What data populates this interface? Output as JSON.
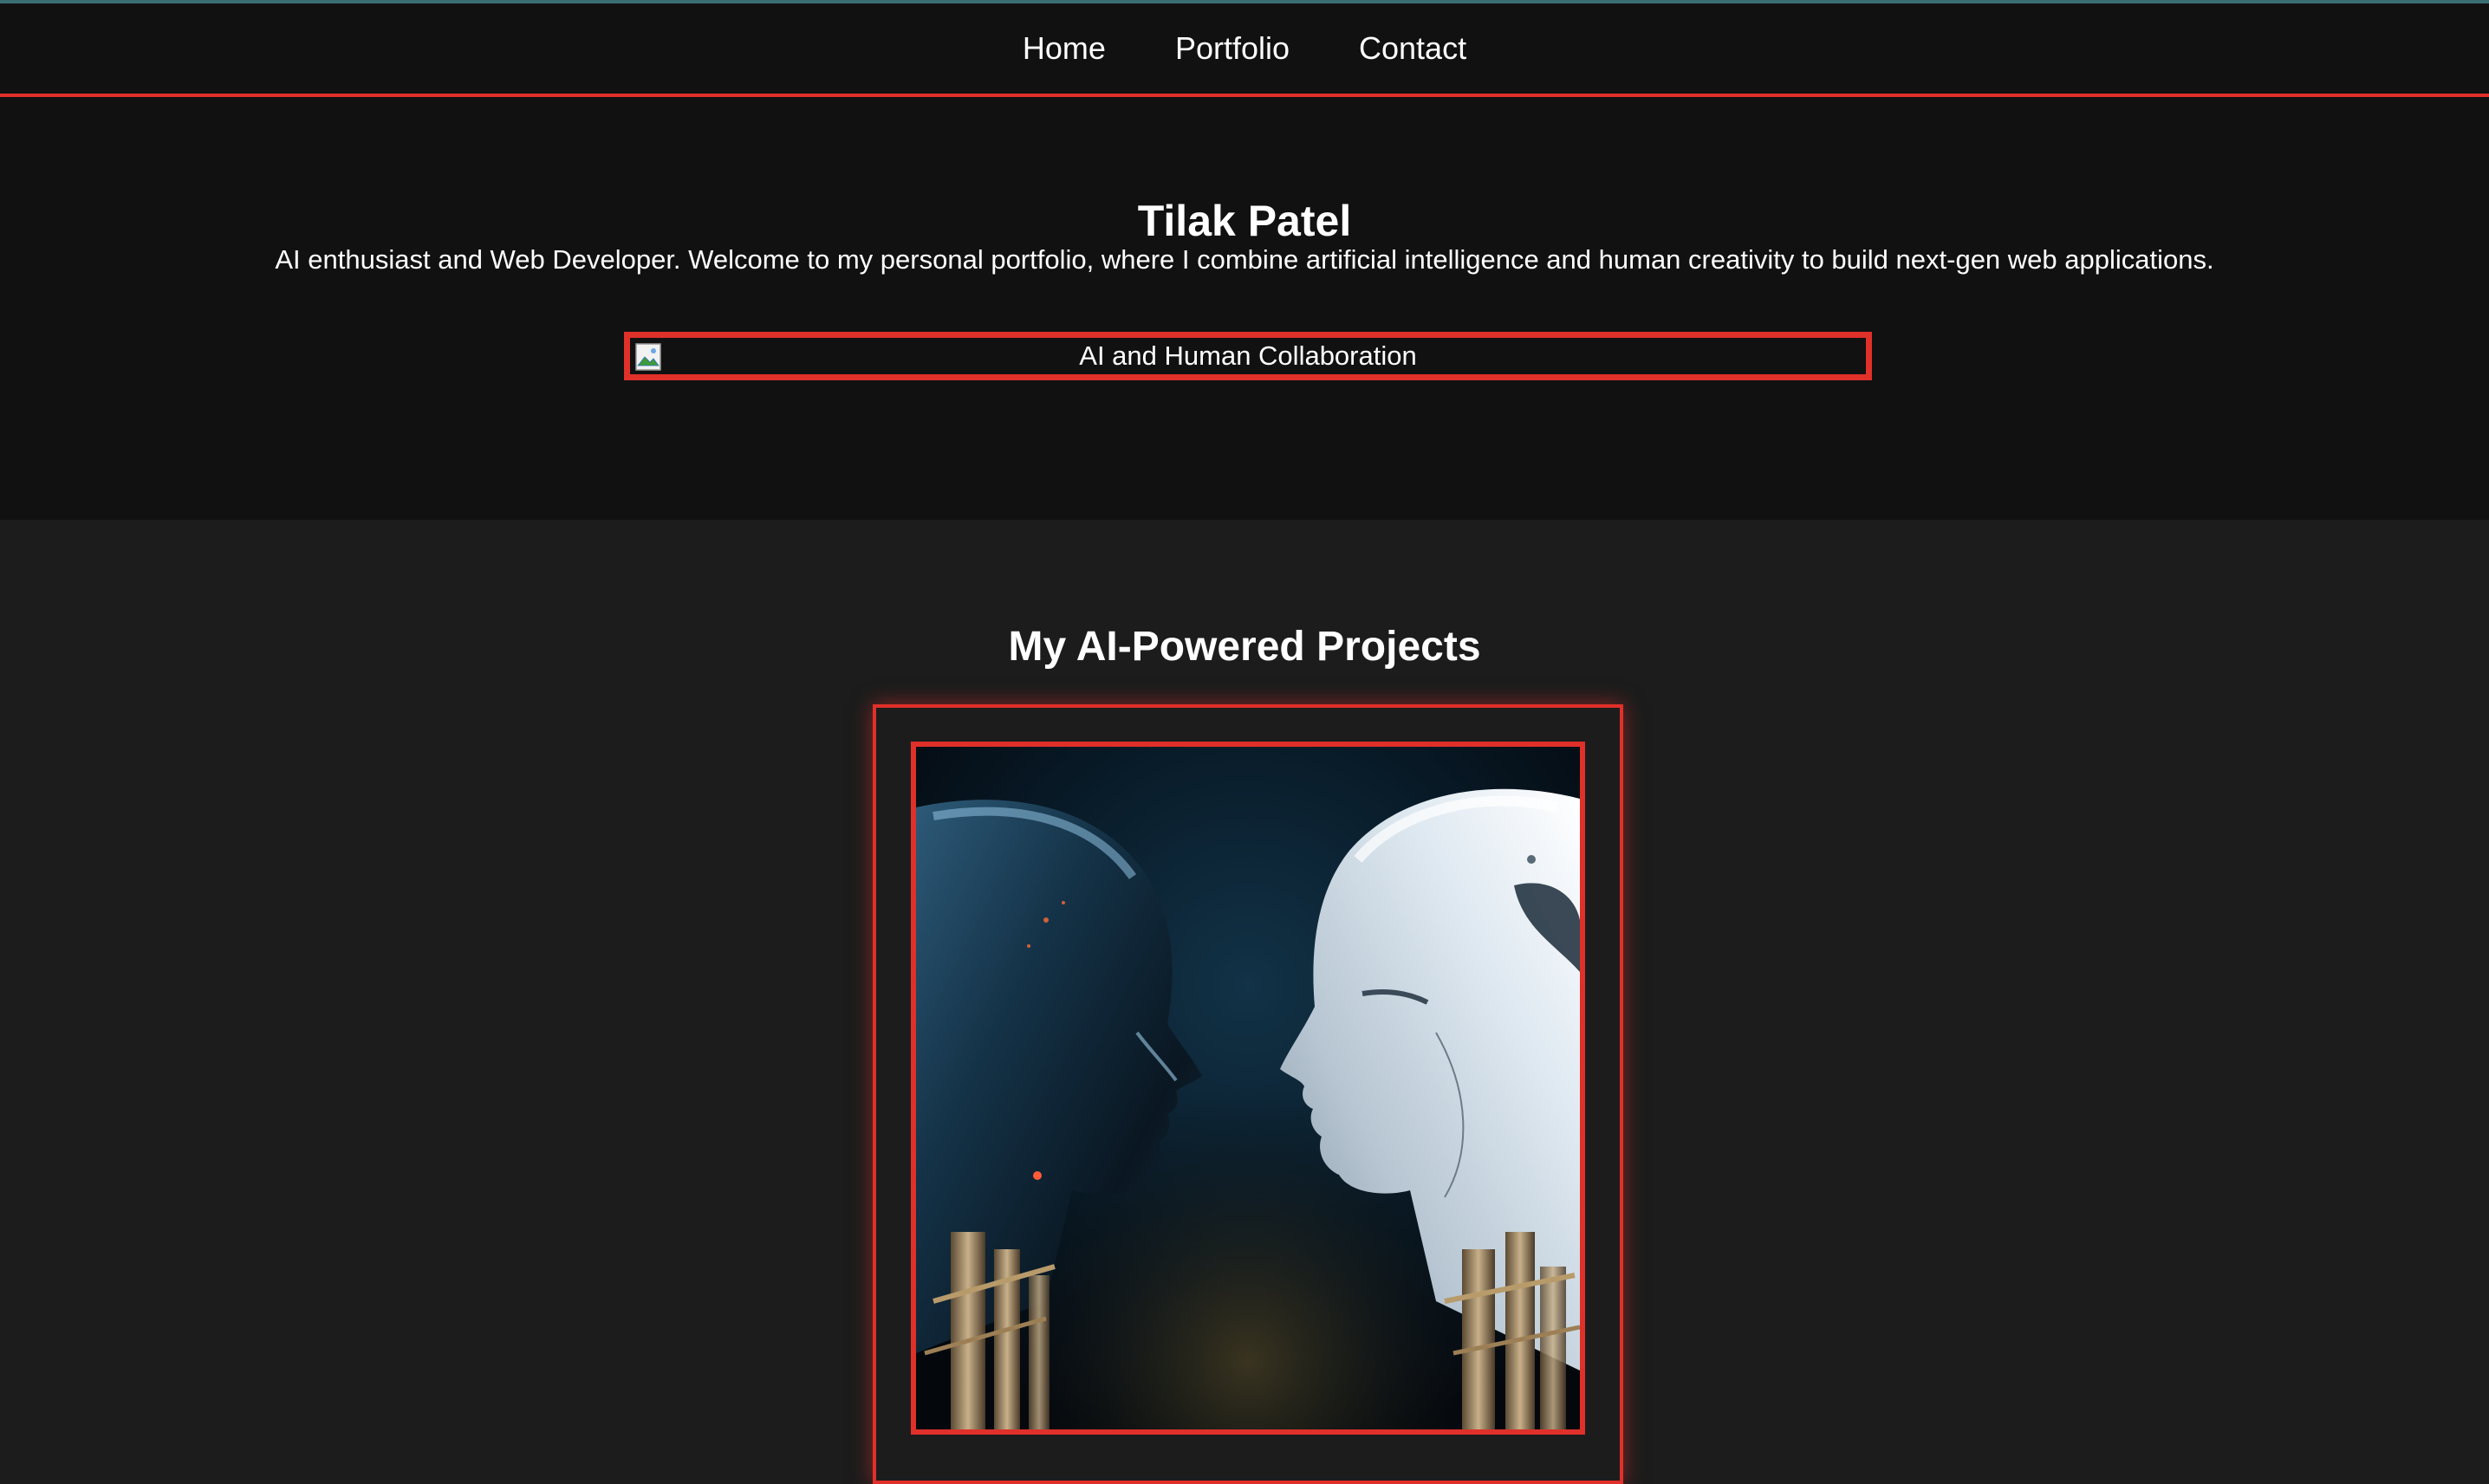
{
  "nav": {
    "items": [
      {
        "label": "Home"
      },
      {
        "label": "Portfolio"
      },
      {
        "label": "Contact"
      }
    ]
  },
  "hero": {
    "title": "Tilak Patel",
    "subtitle": "AI enthusiast and Web Developer. Welcome to my personal portfolio, where I combine artificial intelligence and human creativity to build next-gen web applications.",
    "image_alt": "AI and Human Collaboration",
    "broken_image_icon": "broken-image-icon"
  },
  "projects": {
    "title": "My AI-Powered Projects",
    "image_alt": "AI robot heads facing each other"
  },
  "colors": {
    "accent": "#e0302a",
    "nav_bg": "#111111",
    "hero_bg": "#111111",
    "page_bg": "#1c1c1c",
    "top_line": "#3a6e73"
  }
}
